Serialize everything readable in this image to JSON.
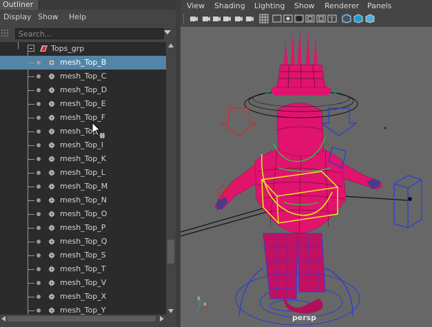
{
  "outliner": {
    "title": "Outliner",
    "menu": [
      "Display",
      "Show",
      "Help"
    ],
    "search_placeholder": "Search...",
    "group_label": "Tops_grp",
    "items": [
      {
        "label": "mesh_Top_B",
        "selected": true
      },
      {
        "label": "mesh_Top_C"
      },
      {
        "label": "mesh_Top_D"
      },
      {
        "label": "mesh_Top_E"
      },
      {
        "label": "mesh_Top_F"
      },
      {
        "label": "mesh_Top_"
      },
      {
        "label": "mesh_Top_I"
      },
      {
        "label": "mesh_Top_K"
      },
      {
        "label": "mesh_Top_L"
      },
      {
        "label": "mesh_Top_M"
      },
      {
        "label": "mesh_Top_N"
      },
      {
        "label": "mesh_Top_O"
      },
      {
        "label": "mesh_Top_P"
      },
      {
        "label": "mesh_Top_Q"
      },
      {
        "label": "mesh_Top_S"
      },
      {
        "label": "mesh_Top_T"
      },
      {
        "label": "mesh_Top_V"
      },
      {
        "label": "mesh_Top_X"
      },
      {
        "label": "mesh_Top_Y"
      }
    ]
  },
  "viewport": {
    "menu": [
      "View",
      "Shading",
      "Lighting",
      "Show",
      "Renderer",
      "Panels"
    ],
    "camera_label": "persp",
    "toolbar_icons": [
      "select-camera-icon",
      "camera-attributes-icon",
      "bookmark-icon",
      "image-plane-icon",
      "2d-pan-icon",
      "grease-pencil-icon",
      "grid-icon",
      "film-gate-icon",
      "resolution-gate-icon",
      "gate-mask-icon",
      "field-chart-icon",
      "safe-action-icon",
      "safe-title-icon",
      "wireframe-icon",
      "smooth-shade-icon",
      "textured-icon"
    ]
  },
  "colors": {
    "selection": "#5285a6",
    "mesh_wire": "#e0136f",
    "control_yellow": "#e6e619",
    "control_blue": "#2a3dd6",
    "control_red": "#d62a2a"
  }
}
